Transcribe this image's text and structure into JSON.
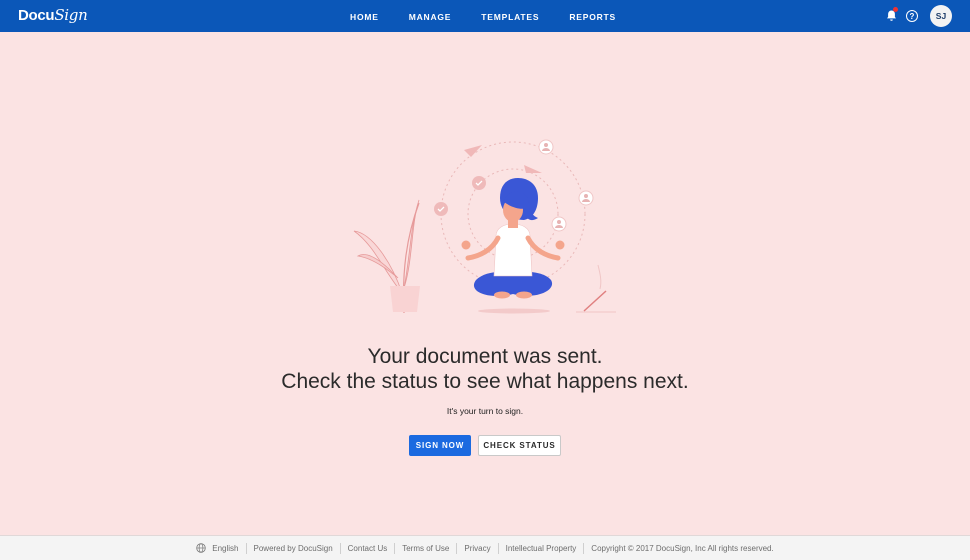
{
  "header": {
    "logo_text": "Docu",
    "logo_script": "Sign",
    "nav": [
      "HOME",
      "MANAGE",
      "TEMPLATES",
      "REPORTS"
    ],
    "avatar_initials": "SJ",
    "brand_color": "#0b57b8"
  },
  "main": {
    "headline_line1": "Your document was sent.",
    "headline_line2": "Check the status to see what happens next.",
    "subtext": "It's your turn to sign.",
    "sign_now_label": "SIGN NOW",
    "check_status_label": "CHECK STATUS",
    "primary_color": "#1b6ae0",
    "background_color": "#fbe3e3"
  },
  "footer": {
    "language": "English",
    "powered_by": "Powered by DocuSign",
    "contact": "Contact Us",
    "terms": "Terms of Use",
    "privacy": "Privacy",
    "ip": "Intellectual Property",
    "copyright": "Copyright © 2017 DocuSign, Inc All rights reserved."
  },
  "icons": [
    "bell-icon",
    "help-icon",
    "globe-icon"
  ]
}
